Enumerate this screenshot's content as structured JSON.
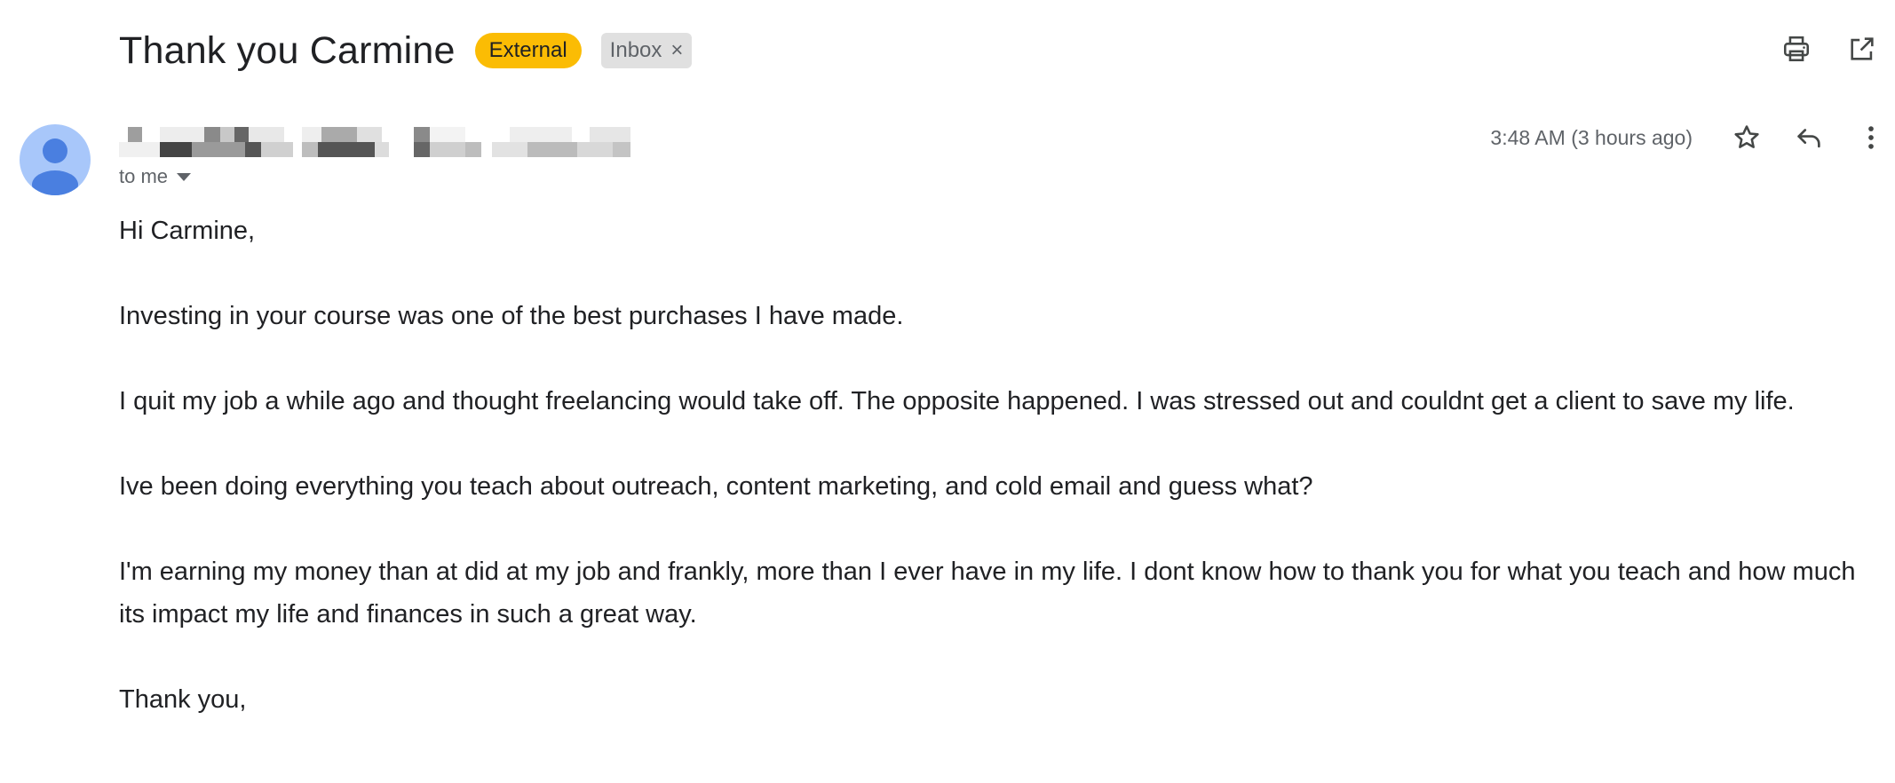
{
  "email": {
    "subject": "Thank you Carmine",
    "labels": {
      "external": "External",
      "inbox": "Inbox",
      "inbox_remove": "×"
    },
    "recipient": "to me",
    "timestamp": "3:48 AM (3 hours ago)",
    "body": {
      "greeting": "Hi Carmine,",
      "p1": "Investing in your course was one of the best purchases I have made.",
      "p2": "I quit my job a while ago and thought freelancing would take off. The opposite happened. I was stressed out and couldnt get a client to save my life.",
      "p3": "Ive been doing everything you teach about outreach, content marketing, and cold email and guess what?",
      "p4": "I'm earning my money than at did at my job and frankly, more than I ever have in my life. I dont know how to thank you for what you teach and how much its impact my life and finances in such a great way.",
      "closing": "Thank you,"
    }
  },
  "icons": {
    "print": "print-icon",
    "open_new_window": "open-in-new-icon",
    "star": "star-icon",
    "reply": "reply-icon",
    "more": "more-vert-icon",
    "avatar": "person-icon",
    "caret": "caret-down-icon"
  },
  "colors": {
    "external_label": "#fbbc04",
    "inbox_label": "#e0e0e0",
    "avatar_bg": "#a8c7fa",
    "avatar_fg": "#4a7fe0"
  }
}
